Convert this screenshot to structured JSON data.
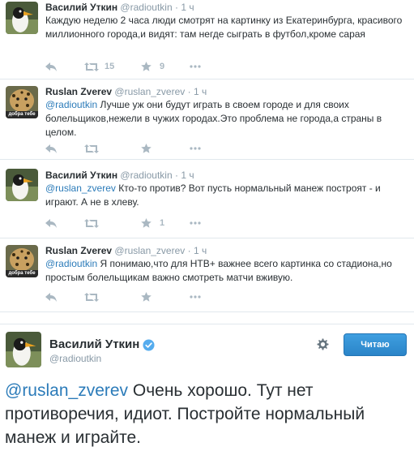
{
  "tweets": [
    {
      "name": "Василий Уткин",
      "handle": "@radioutkin",
      "sep": "·",
      "time": "1 ч",
      "mention": "",
      "text": "Каждую неделю 2 часа люди смотрят на картинку из Екатеринбурга, красивого миллионного города,и видят: там негде сыграть в футбол,кроме сарая",
      "retweets": "15",
      "favorites": "9"
    },
    {
      "name": "Ruslan Zverev",
      "handle": "@ruslan_zverev",
      "sep": "·",
      "time": "1 ч",
      "mention": "@radioutkin",
      "text": " Лучше уж они будут играть в своем городе и для своих болельщиков,нежели в чужих городах.Это проблема не города,а страны в целом.",
      "retweets": "",
      "favorites": ""
    },
    {
      "name": "Василий Уткин",
      "handle": "@radioutkin",
      "sep": "·",
      "time": "1 ч",
      "mention": "@ruslan_zverev",
      "text": " Кто-то против? Вот пусть нормальный манеж построят - и играют. А не в хлеву.",
      "retweets": "",
      "favorites": "1"
    },
    {
      "name": "Ruslan Zverev",
      "handle": "@ruslan_zverev",
      "sep": "·",
      "time": "1 ч",
      "mention": "@radioutkin",
      "text": " Я понимаю,что для НТВ+ важнее всего картинка со стадиона,но простым болельщикам важно смотреть матчи вживую.",
      "retweets": "",
      "favorites": ""
    }
  ],
  "avatar_caption": "добра тебе",
  "main": {
    "name": "Василий Уткин",
    "handle": "@radioutkin",
    "follow_label": "Читаю",
    "mention": "@ruslan_zverev",
    "text": " Очень хорошо. Тут нет противоречия, идиот. Постройте нормальный манеж и играйте."
  },
  "icons": {
    "reply": "reply-icon",
    "retweet": "retweet-icon",
    "favorite": "star-icon",
    "more": "more-icon",
    "gear": "gear-icon",
    "verified": "verified-icon"
  },
  "colors": {
    "link": "#2b7bb9",
    "muted": "#8899a6",
    "action": "#aab8c2",
    "follow": "#2a84c8"
  }
}
